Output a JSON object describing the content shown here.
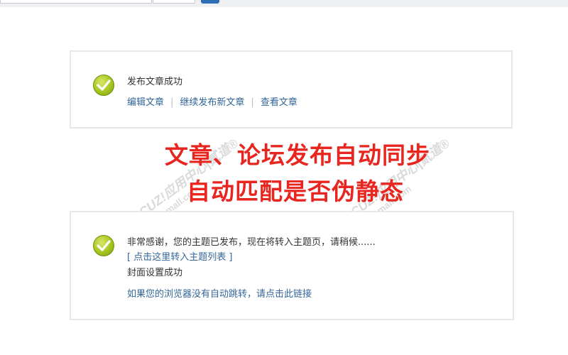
{
  "panel1": {
    "success_message": "发布文章成功",
    "links": [
      "编辑文章",
      "继续发布新文章",
      "查看文章"
    ]
  },
  "overlay": {
    "line1": "文章、论坛发布自动同步",
    "line2": "自动匹配是否伪静态"
  },
  "panel2": {
    "thanks_message": "非常感谢，您的主题已发布，现在将转入主题页，请稍候......",
    "list_link": "[ 点击这里转入主题列表 ]",
    "cover_message": "封面设置成功",
    "redirect_link": "如果您的浏览器没有自动跳转，请点击此链接"
  },
  "watermark": {
    "brand": "DISCUZ!应用中心|贰道®",
    "domain": "addon.dismall.com"
  },
  "colors": {
    "link": "#336699",
    "overlay_text": "#e8251f",
    "success_icon": "#a6c51f"
  }
}
